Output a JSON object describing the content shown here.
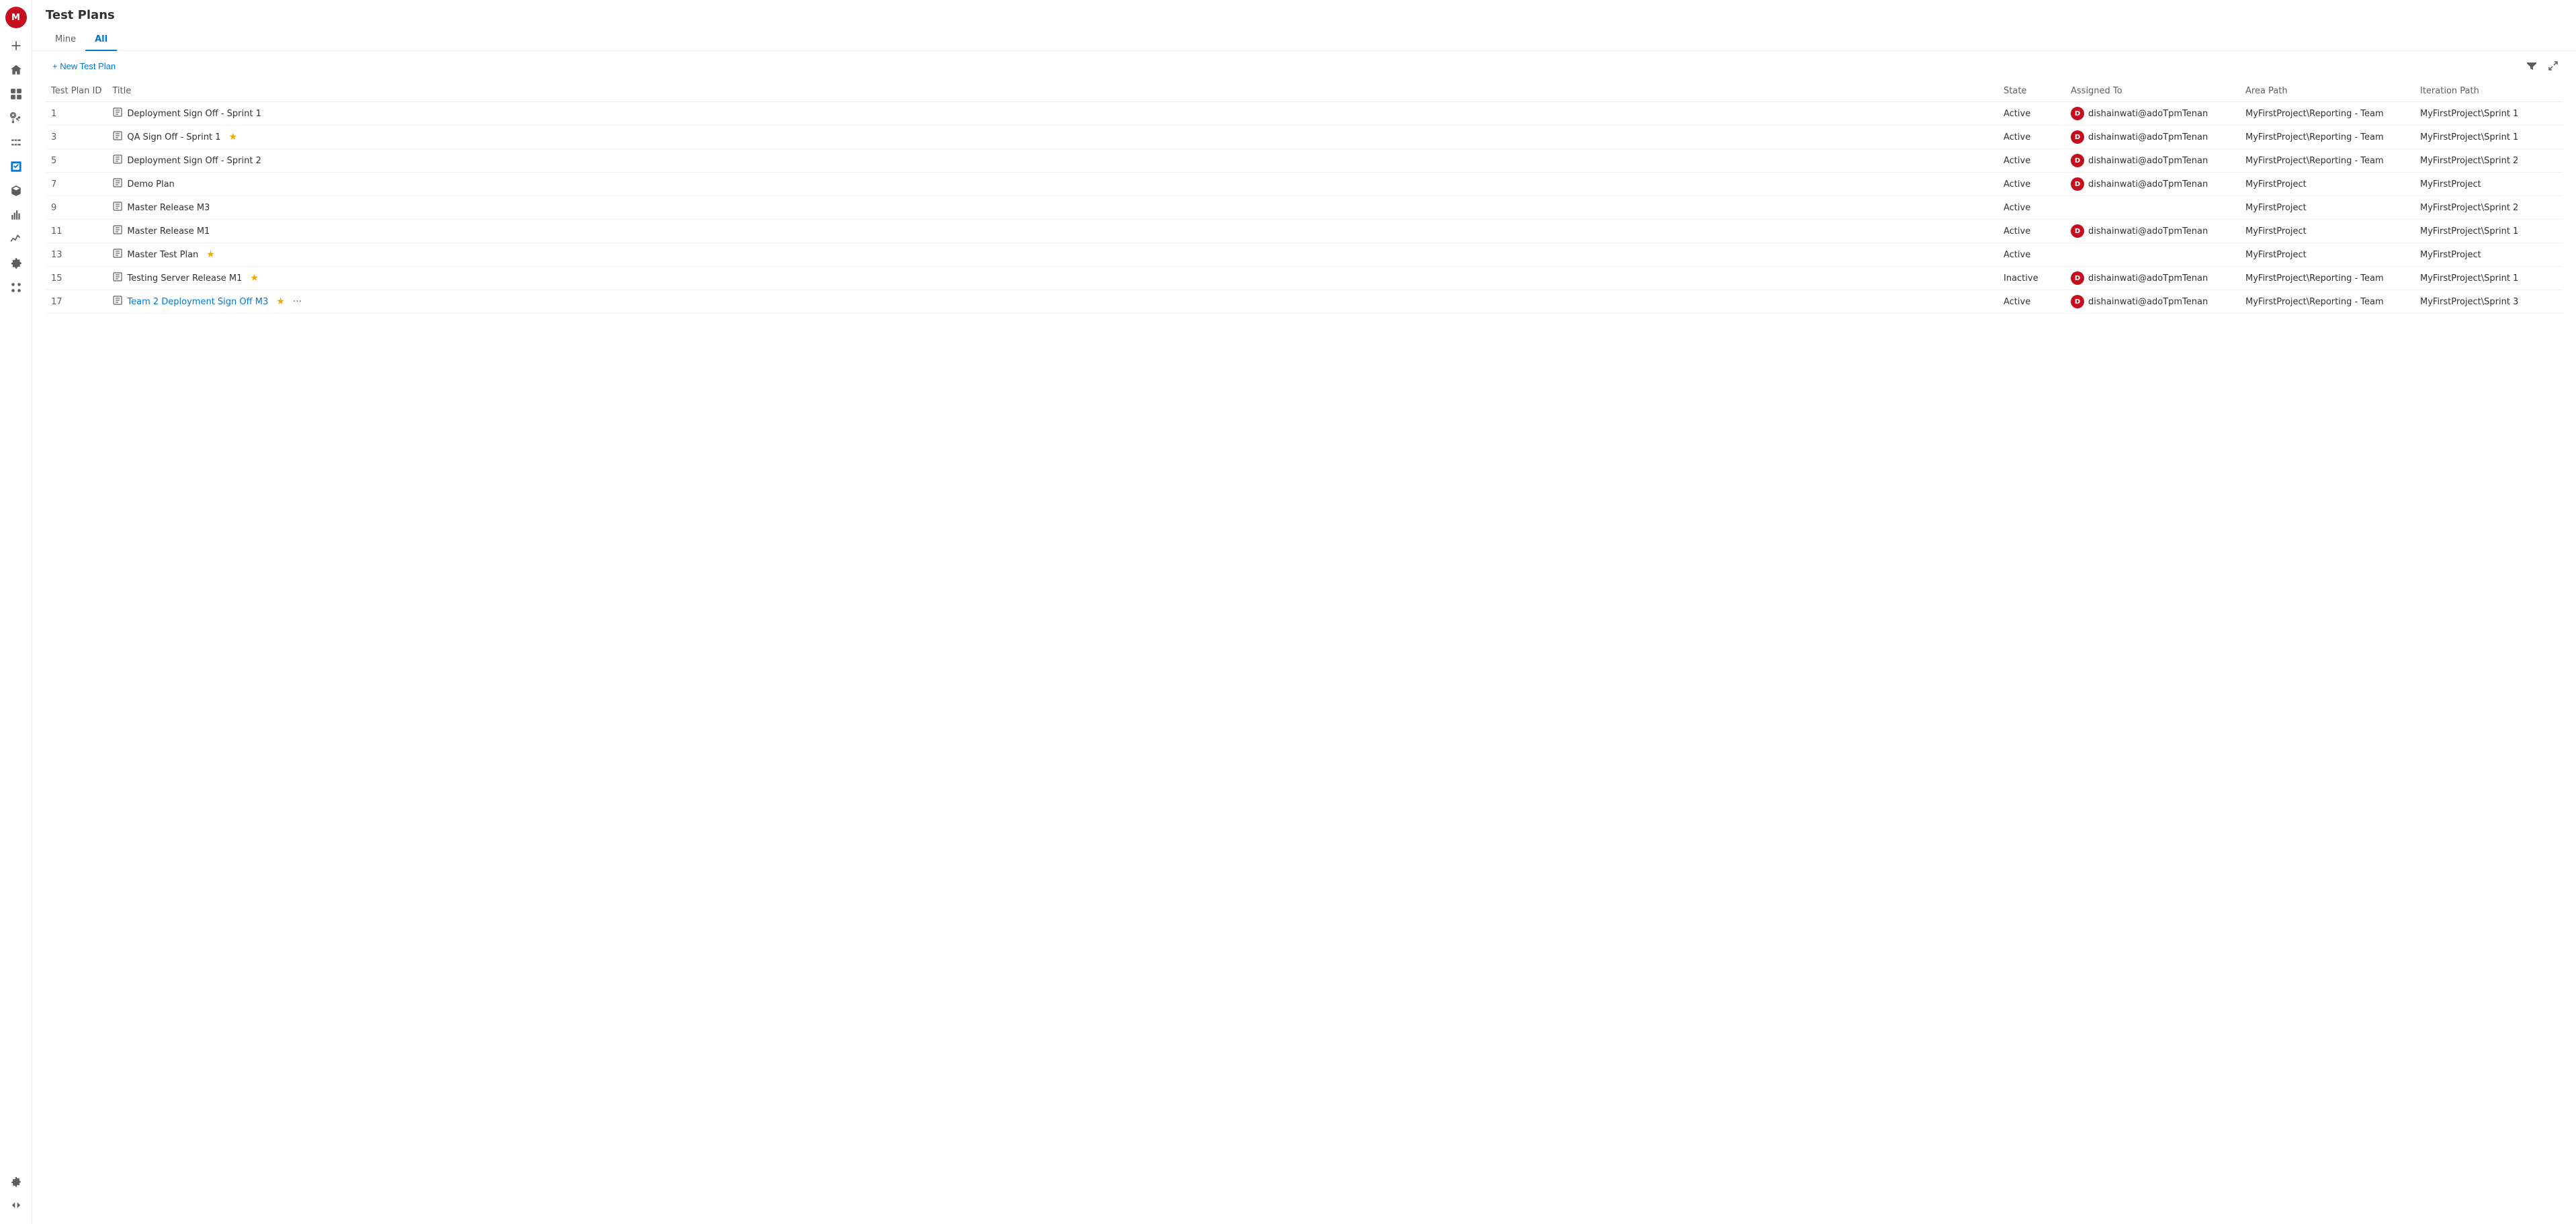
{
  "page": {
    "title": "Test Plans"
  },
  "tabs": [
    {
      "id": "mine",
      "label": "Mine",
      "active": false
    },
    {
      "id": "all",
      "label": "All",
      "active": true
    }
  ],
  "toolbar": {
    "new_plan_label": "+ New Test Plan",
    "filter_icon": "filter",
    "fullscreen_icon": "fullscreen"
  },
  "table": {
    "columns": [
      {
        "id": "plan_id",
        "label": "Test Plan ID"
      },
      {
        "id": "title",
        "label": "Title"
      },
      {
        "id": "state",
        "label": "State"
      },
      {
        "id": "assigned_to",
        "label": "Assigned To"
      },
      {
        "id": "area_path",
        "label": "Area Path"
      },
      {
        "id": "iteration_path",
        "label": "Iteration Path"
      }
    ],
    "rows": [
      {
        "id": "1",
        "title": "Deployment Sign Off - Sprint 1",
        "is_link": false,
        "starred": false,
        "more": false,
        "state": "Active",
        "assigned_to": "dishainwati@adoTpmTenan",
        "has_avatar": true,
        "area_path": "MyFirstProject\\Reporting - Team",
        "iteration_path": "MyFirstProject\\Sprint 1"
      },
      {
        "id": "3",
        "title": "QA Sign Off - Sprint 1",
        "is_link": false,
        "starred": true,
        "more": false,
        "state": "Active",
        "assigned_to": "dishainwati@adoTpmTenan",
        "has_avatar": true,
        "area_path": "MyFirstProject\\Reporting - Team",
        "iteration_path": "MyFirstProject\\Sprint 1"
      },
      {
        "id": "5",
        "title": "Deployment Sign Off - Sprint 2",
        "is_link": false,
        "starred": false,
        "more": false,
        "state": "Active",
        "assigned_to": "dishainwati@adoTpmTenan",
        "has_avatar": true,
        "area_path": "MyFirstProject\\Reporting - Team",
        "iteration_path": "MyFirstProject\\Sprint 2"
      },
      {
        "id": "7",
        "title": "Demo Plan",
        "is_link": false,
        "starred": false,
        "more": false,
        "state": "Active",
        "assigned_to": "dishainwati@adoTpmTenan",
        "has_avatar": true,
        "area_path": "MyFirstProject",
        "iteration_path": "MyFirstProject"
      },
      {
        "id": "9",
        "title": "Master Release M3",
        "is_link": false,
        "starred": false,
        "more": false,
        "state": "Active",
        "assigned_to": "",
        "has_avatar": false,
        "area_path": "MyFirstProject",
        "iteration_path": "MyFirstProject\\Sprint 2"
      },
      {
        "id": "11",
        "title": "Master Release M1",
        "is_link": false,
        "starred": false,
        "more": false,
        "state": "Active",
        "assigned_to": "dishainwati@adoTpmTenan",
        "has_avatar": true,
        "area_path": "MyFirstProject",
        "iteration_path": "MyFirstProject\\Sprint 1"
      },
      {
        "id": "13",
        "title": "Master Test Plan",
        "is_link": false,
        "starred": true,
        "more": false,
        "state": "Active",
        "assigned_to": "",
        "has_avatar": false,
        "area_path": "MyFirstProject",
        "iteration_path": "MyFirstProject"
      },
      {
        "id": "15",
        "title": "Testing Server Release M1",
        "is_link": false,
        "starred": true,
        "more": false,
        "state": "Inactive",
        "assigned_to": "dishainwati@adoTpmTenan",
        "has_avatar": true,
        "area_path": "MyFirstProject\\Reporting - Team",
        "iteration_path": "MyFirstProject\\Sprint 1"
      },
      {
        "id": "17",
        "title": "Team 2 Deployment Sign Off M3",
        "is_link": true,
        "starred": true,
        "more": true,
        "state": "Active",
        "assigned_to": "dishainwati@adoTpmTenan",
        "has_avatar": true,
        "area_path": "MyFirstProject\\Reporting - Team",
        "iteration_path": "MyFirstProject\\Sprint 3"
      }
    ]
  },
  "sidebar": {
    "avatar_label": "M",
    "icons": [
      {
        "name": "add-icon",
        "symbol": "+"
      },
      {
        "name": "home-icon",
        "symbol": "⌂"
      },
      {
        "name": "boards-icon",
        "symbol": "▦"
      },
      {
        "name": "repos-icon",
        "symbol": "⎇"
      },
      {
        "name": "pipelines-icon",
        "symbol": "▶"
      },
      {
        "name": "testplans-icon",
        "symbol": "✓"
      },
      {
        "name": "artifacts-icon",
        "symbol": "📦"
      },
      {
        "name": "reports-icon",
        "symbol": "📊"
      },
      {
        "name": "analytics-icon",
        "symbol": "📈"
      },
      {
        "name": "project-icon",
        "symbol": "🔷"
      },
      {
        "name": "overview-icon",
        "symbol": "⊞"
      }
    ],
    "settings_label": "⚙",
    "expand_label": "«"
  }
}
